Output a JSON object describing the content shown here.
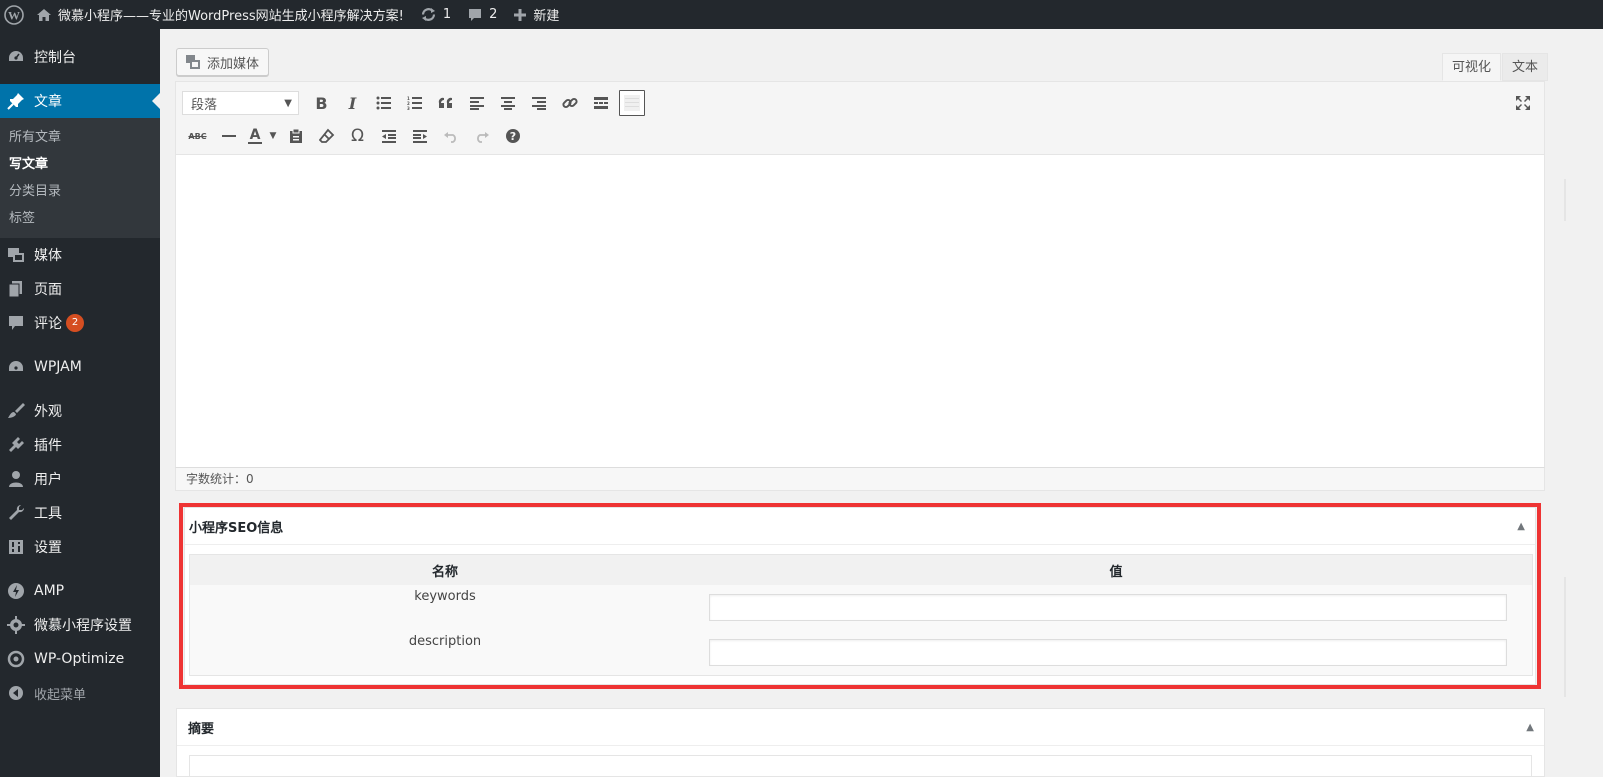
{
  "adminbar": {
    "site_title": "微慕小程序——专业的WordPress网站生成小程序解决方案!",
    "updates_count": "1",
    "comments_count": "2",
    "new_label": "新建"
  },
  "sidebar": {
    "dashboard": "控制台",
    "posts": "文章",
    "posts_sub": [
      "所有文章",
      "写文章",
      "分类目录",
      "标签"
    ],
    "media": "媒体",
    "pages": "页面",
    "comments": "评论",
    "comments_badge": "2",
    "wpjam": "WPJAM",
    "appearance": "外观",
    "plugins": "插件",
    "users": "用户",
    "tools": "工具",
    "settings": "设置",
    "amp": "AMP",
    "weimu_settings": "微慕小程序设置",
    "wp_optimize": "WP-Optimize",
    "collapse": "收起菜单"
  },
  "editor": {
    "add_media": "添加媒体",
    "tab_visual": "可视化",
    "tab_text": "文本",
    "format_value": "段落",
    "word_count": "字数统计：0"
  },
  "seo_box": {
    "title": "小程序SEO信息",
    "col_name": "名称",
    "col_value": "值",
    "rows": [
      {
        "name": "keywords",
        "value": ""
      },
      {
        "name": "description",
        "value": ""
      }
    ]
  },
  "excerpt_box": {
    "title": "摘要"
  },
  "colors": {
    "adminbar_bg": "#23282d",
    "menu_current": "#0073aa",
    "highlight_border": "#ee3333",
    "badge": "#d54e21"
  }
}
